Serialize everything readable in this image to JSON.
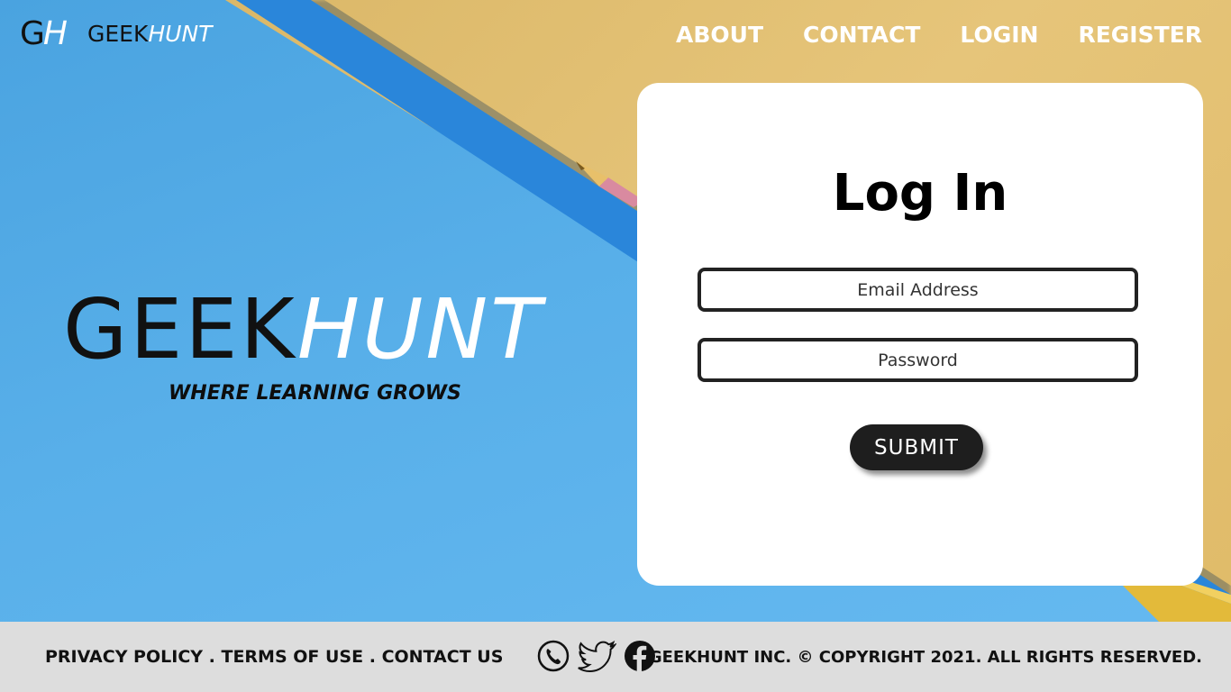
{
  "nav": {
    "logo_mark_g": "G",
    "logo_mark_h": "H",
    "logo_geek": "GEEK",
    "logo_hunt": "HUNT",
    "links": [
      "ABOUT",
      "CONTACT",
      "LOGIN",
      "REGISTER"
    ]
  },
  "hero": {
    "brand_geek": "GEEK",
    "brand_hunt": "HUNT",
    "tagline": "WHERE LEARNING GROWS"
  },
  "login": {
    "title": "Log In",
    "email_placeholder": "Email Address",
    "password_placeholder": "Password",
    "submit_label": "SUBMIT"
  },
  "footer": {
    "links": [
      "PRIVACY POLICY",
      "TERMS OF USE",
      "CONTACT US"
    ],
    "separator": " . ",
    "social_icons": [
      "phone-icon",
      "twitter-icon",
      "facebook-icon"
    ],
    "copyright": "GEEKHUNT INC. © COPYRIGHT 2021. ALL RIGHTS RESERVED."
  },
  "colors": {
    "sky_blue": "#58afe9",
    "stripe_blue": "#2a86da",
    "paper_yellow": "#e2bd6e",
    "card_white": "#ffffff",
    "button_dark": "#1e1e1e",
    "footer_grey": "#dddddd"
  }
}
